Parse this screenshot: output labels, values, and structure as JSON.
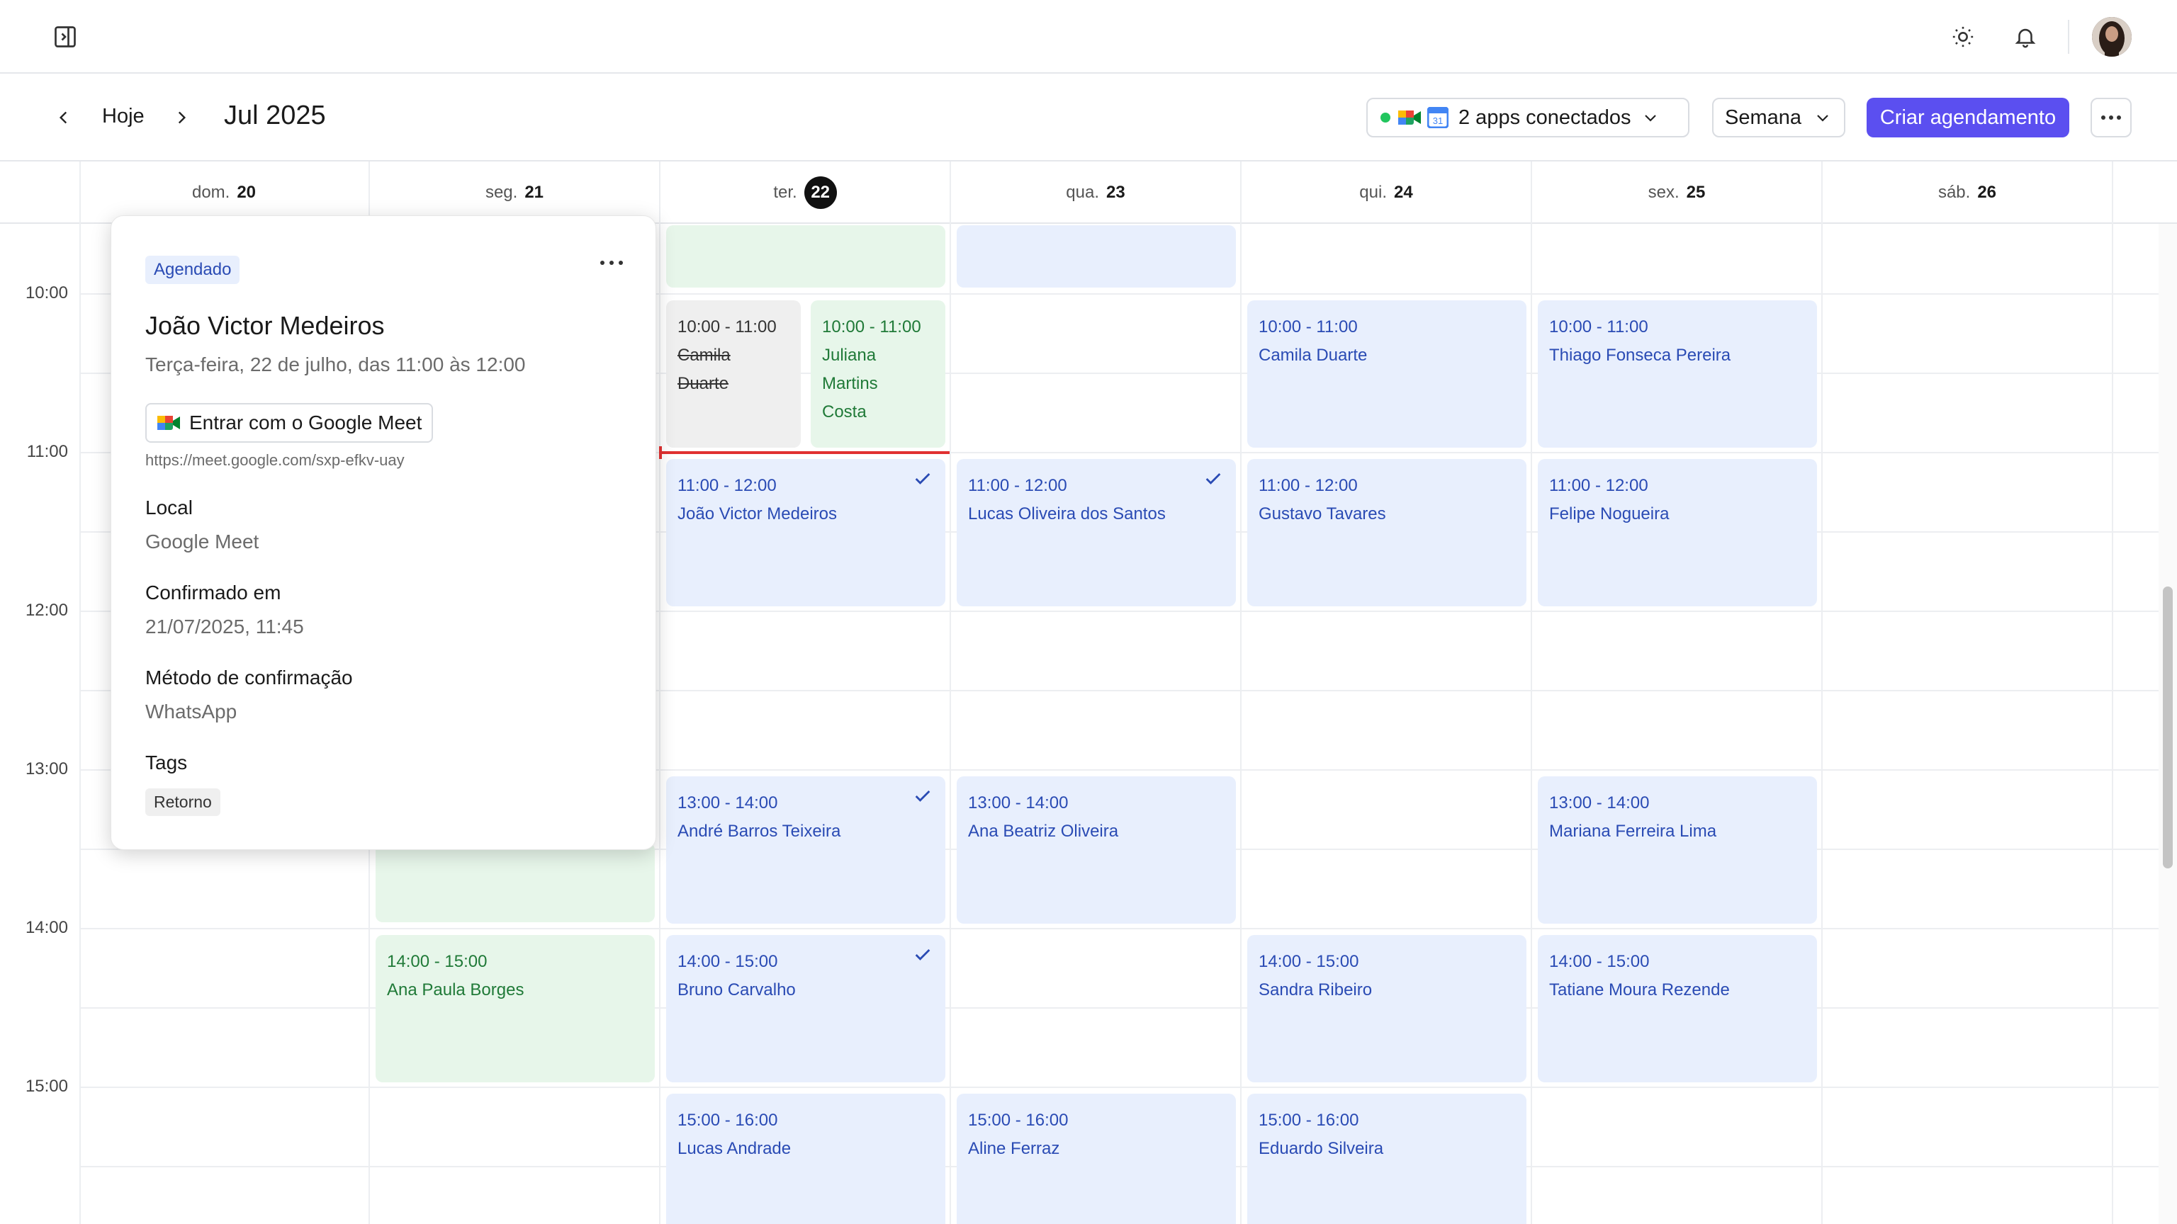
{
  "toolbar": {
    "today_label": "Hoje",
    "month_label": "Jul 2025",
    "apps_label": "2 apps conectados",
    "view_label": "Semana",
    "create_label": "Criar agendamento"
  },
  "colors": {
    "accent": "#5b4ff0",
    "event_blue_bg": "#e8effd",
    "event_blue_text": "#2a4bb4",
    "event_green_bg": "#e7f6ea",
    "event_green_text": "#207a38",
    "now_line": "#e03131"
  },
  "days": [
    {
      "dow": "dom.",
      "num": "20"
    },
    {
      "dow": "seg.",
      "num": "21"
    },
    {
      "dow": "ter.",
      "num": "22"
    },
    {
      "dow": "qua.",
      "num": "23"
    },
    {
      "dow": "qui.",
      "num": "24"
    },
    {
      "dow": "sex.",
      "num": "25"
    },
    {
      "dow": "sáb.",
      "num": "26"
    }
  ],
  "hours": [
    "10:00",
    "11:00",
    "12:00",
    "13:00",
    "14:00",
    "15:00"
  ],
  "events": {
    "tue_1000_a": {
      "time": "10:00 - 11:00",
      "name_1": "Camila",
      "name_2": "Duarte"
    },
    "tue_1000_b": {
      "time": "10:00 - 11:00",
      "name_1": "Juliana",
      "name_2": "Martins",
      "name_3": "Costa"
    },
    "tue_1100": {
      "time": "11:00 - 12:00",
      "name": "João Victor Medeiros"
    },
    "tue_1300": {
      "time": "13:00 - 14:00",
      "name": "André Barros Teixeira"
    },
    "tue_1400": {
      "time": "14:00 - 15:00",
      "name": "Bruno Carvalho"
    },
    "tue_1500": {
      "time": "15:00 - 16:00",
      "name": "Lucas Andrade"
    },
    "wed_1100": {
      "time": "11:00 - 12:00",
      "name": "Lucas Oliveira dos Santos"
    },
    "wed_1300": {
      "time": "13:00 - 14:00",
      "name": "Ana Beatriz Oliveira"
    },
    "wed_1500": {
      "time": "15:00 - 16:00",
      "name": "Aline Ferraz"
    },
    "thu_1000": {
      "time": "10:00 - 11:00",
      "name": "Camila Duarte"
    },
    "thu_1100": {
      "time": "11:00 - 12:00",
      "name": "Gustavo Tavares"
    },
    "thu_1400": {
      "time": "14:00 - 15:00",
      "name": "Sandra Ribeiro"
    },
    "thu_1500": {
      "time": "15:00 - 16:00",
      "name": "Eduardo Silveira"
    },
    "fri_1000": {
      "time": "10:00 - 11:00",
      "name": "Thiago Fonseca Pereira"
    },
    "fri_1100": {
      "time": "11:00 - 12:00",
      "name": "Felipe Nogueira"
    },
    "fri_1300": {
      "time": "13:00 - 14:00",
      "name": "Mariana Ferreira Lima"
    },
    "fri_1400": {
      "time": "14:00 - 15:00",
      "name": "Tatiane Moura Rezende"
    },
    "mon_1400": {
      "time": "14:00 - 15:00",
      "name": "Ana Paula Borges"
    }
  },
  "popup": {
    "status": "Agendado",
    "name": "João Victor Medeiros",
    "datetime": "Terça-feira, 22 de julho, das 11:00 às 12:00",
    "meet_button": "Entrar com o Google Meet",
    "meet_url": "https://meet.google.com/sxp-efkv-uay",
    "local_label": "Local",
    "local_value": "Google Meet",
    "confirmed_label": "Confirmado em",
    "confirmed_value": "21/07/2025, 11:45",
    "method_label": "Método de confirmação",
    "method_value": "WhatsApp",
    "tags_label": "Tags",
    "tag": "Retorno"
  }
}
